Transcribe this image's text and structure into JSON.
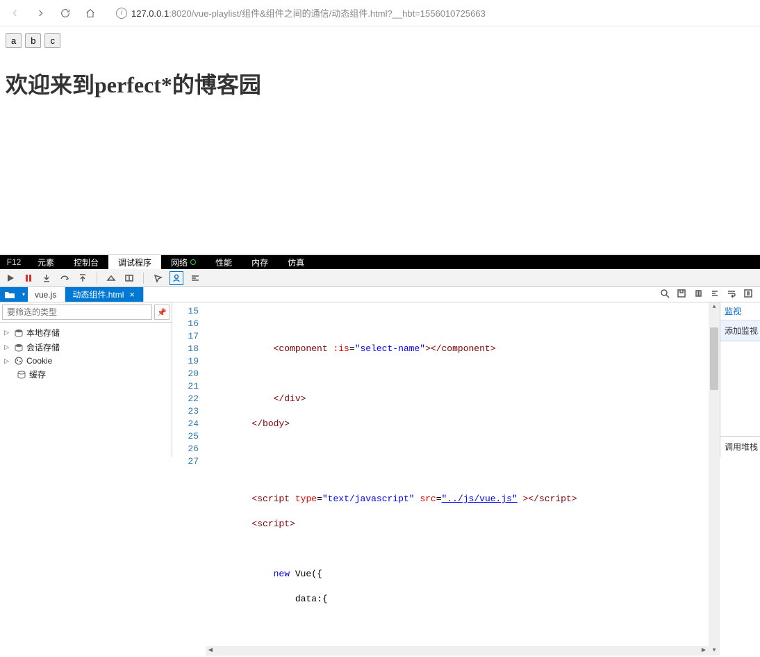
{
  "browser": {
    "url_ip": "127.0.0.1",
    "url_rest": ":8020/vue-playlist/组件&组件之间的通信/动态组件.html?__hbt=1556010725663"
  },
  "page": {
    "buttons": [
      "a",
      "b",
      "c"
    ],
    "heading": "欢迎来到perfect*的博客园"
  },
  "devtools": {
    "f12": "F12",
    "tabs": {
      "elements": "元素",
      "console": "控制台",
      "debugger": "调试程序",
      "network": "网络",
      "performance": "性能",
      "memory": "内存",
      "emulation": "仿真"
    },
    "file_tabs": {
      "file1": "vue.js",
      "file2": "动态组件.html"
    },
    "filter_placeholder": "要筛选的类型",
    "tree": {
      "local": "本地存储",
      "session": "会话存储",
      "cookie": "Cookie",
      "cache": "缓存"
    },
    "code": {
      "lines": {
        "l15": "15",
        "l16": "16",
        "l17": "17",
        "l18": "18",
        "l19": "19",
        "l20": "20",
        "l21": "21",
        "l22": "22",
        "l23": "23",
        "l24": "24",
        "l25": "25",
        "l26": "26",
        "l27": "27"
      },
      "t16_open": "<component ",
      "t16_attr": ":is",
      "t16_eq": "=",
      "t16_val": "\"select-name\"",
      "t16_close": "></component>",
      "t18": "</div>",
      "t19": "</body>",
      "t22_pre": "<script ",
      "t22_a1": "type",
      "t22_v1": "\"text/javascript\"",
      "t22_a2": "src",
      "t22_v2": "\"../js/vue.js\"",
      "t22_post": " ></",
      "t22_end": "script>",
      "t23_open": "<script>",
      "t25_new": "new",
      "t25_rest": " Vue({",
      "t26": "data:{"
    },
    "right": {
      "watch": "监视",
      "add_watch": "添加监视",
      "callstack": "调用堆栈"
    }
  }
}
